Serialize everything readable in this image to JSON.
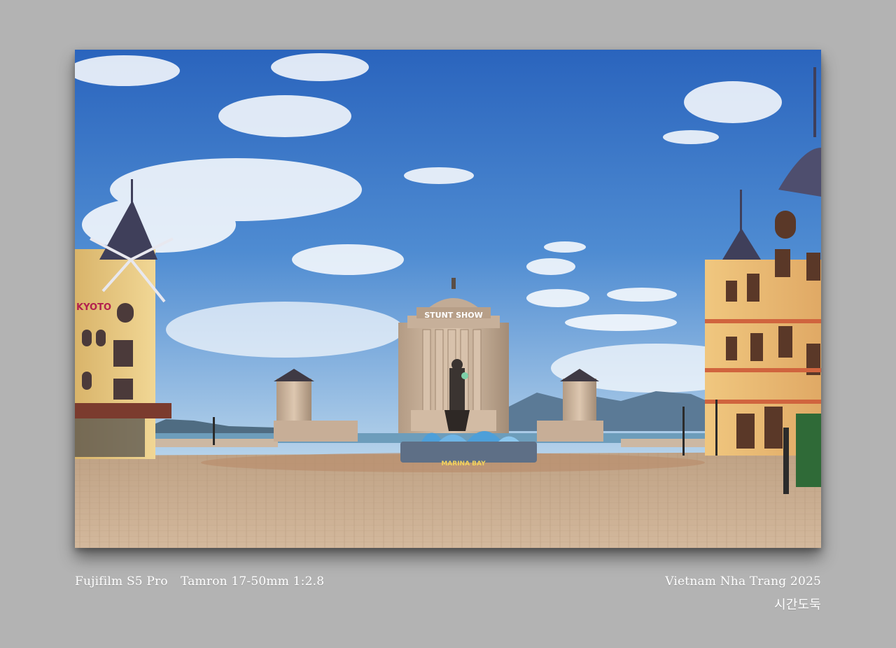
{
  "photo": {
    "sign_building": "STUNT SHOW",
    "sign_fountain": "MARINA BAY",
    "sign_left_building": "KYOTO"
  },
  "captions": {
    "camera": "Fujifilm S5 Pro",
    "lens": "Tamron 17-50mm 1:2.8",
    "location": "Vietnam Nha Trang 2025",
    "author": "시간도둑"
  },
  "colors": {
    "background": "#b3b3b3",
    "sky_top": "#2d6cc4",
    "sky_bottom": "#a9c9e6",
    "plaza": "#c9ab8c",
    "building_yellow": "#e9c77c",
    "building_stone": "#cdb49a"
  }
}
